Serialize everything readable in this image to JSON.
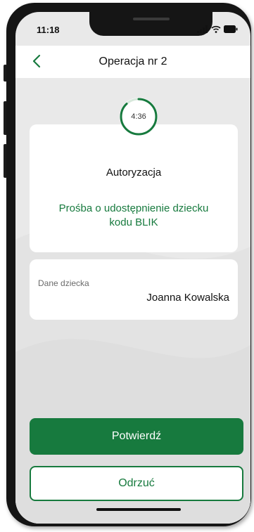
{
  "status_bar": {
    "time": "11:18",
    "icons": [
      "signal-icon",
      "wifi-icon",
      "battery-icon"
    ]
  },
  "header": {
    "back_icon": "chevron-left-icon",
    "title": "Operacja nr 2"
  },
  "timer": {
    "value": "4:36",
    "progress": 0.88
  },
  "auth_card": {
    "title": "Autoryzacja",
    "description": "Prośba o udostępnienie dziecku kodu BLIK"
  },
  "child_card": {
    "label": "Dane dziecka",
    "value": "Joanna Kowalska"
  },
  "actions": {
    "confirm_label": "Potwierdź",
    "reject_label": "Odrzuć"
  },
  "colors": {
    "accent": "#177a3e",
    "background": "#e9e9e9",
    "card": "#ffffff"
  }
}
